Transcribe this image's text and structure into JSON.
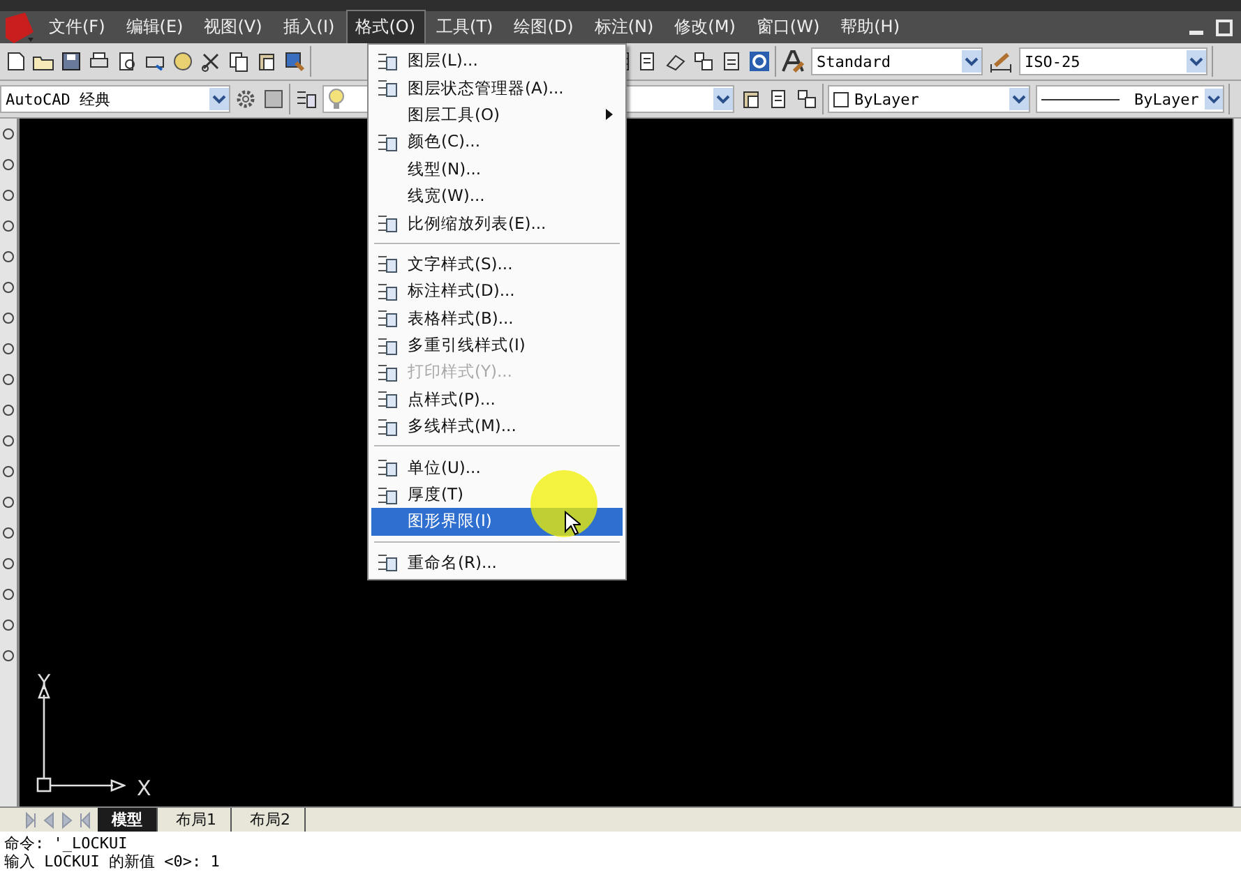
{
  "menubar": {
    "items": [
      {
        "label": "文件(F)",
        "selected": false
      },
      {
        "label": "编辑(E)",
        "selected": false
      },
      {
        "label": "视图(V)",
        "selected": false
      },
      {
        "label": "插入(I)",
        "selected": false
      },
      {
        "label": "格式(O)",
        "selected": true
      },
      {
        "label": "工具(T)",
        "selected": false
      },
      {
        "label": "绘图(D)",
        "selected": false
      },
      {
        "label": "标注(N)",
        "selected": false
      },
      {
        "label": "修改(M)",
        "selected": false
      },
      {
        "label": "窗口(W)",
        "selected": false
      },
      {
        "label": "帮助(H)",
        "selected": false
      }
    ]
  },
  "toolbar": {
    "text_style": "Standard",
    "dim_style": "ISO-25",
    "workspace": "AutoCAD 经典",
    "color_control": "ByLayer",
    "linetype": "ByLayer"
  },
  "format_menu": {
    "items": [
      {
        "kind": "item",
        "label": "图层(L)...",
        "icon": true,
        "disabled": false,
        "selected": false,
        "submenu": false
      },
      {
        "kind": "item",
        "label": "图层状态管理器(A)...",
        "icon": true,
        "disabled": false,
        "selected": false,
        "submenu": false
      },
      {
        "kind": "item",
        "label": "图层工具(O)",
        "icon": false,
        "disabled": false,
        "selected": false,
        "submenu": true
      },
      {
        "kind": "item",
        "label": "颜色(C)...",
        "icon": true,
        "disabled": false,
        "selected": false,
        "submenu": false
      },
      {
        "kind": "item",
        "label": "线型(N)...",
        "icon": false,
        "disabled": false,
        "selected": false,
        "submenu": false
      },
      {
        "kind": "item",
        "label": "线宽(W)...",
        "icon": false,
        "disabled": false,
        "selected": false,
        "submenu": false
      },
      {
        "kind": "item",
        "label": "比例缩放列表(E)...",
        "icon": true,
        "disabled": false,
        "selected": false,
        "submenu": false
      },
      {
        "kind": "separator"
      },
      {
        "kind": "item",
        "label": "文字样式(S)...",
        "icon": true,
        "disabled": false,
        "selected": false,
        "submenu": false
      },
      {
        "kind": "item",
        "label": "标注样式(D)...",
        "icon": true,
        "disabled": false,
        "selected": false,
        "submenu": false
      },
      {
        "kind": "item",
        "label": "表格样式(B)...",
        "icon": true,
        "disabled": false,
        "selected": false,
        "submenu": false
      },
      {
        "kind": "item",
        "label": "多重引线样式(I)",
        "icon": true,
        "disabled": false,
        "selected": false,
        "submenu": false
      },
      {
        "kind": "item",
        "label": "打印样式(Y)...",
        "icon": true,
        "disabled": true,
        "selected": false,
        "submenu": false
      },
      {
        "kind": "item",
        "label": "点样式(P)...",
        "icon": true,
        "disabled": false,
        "selected": false,
        "submenu": false
      },
      {
        "kind": "item",
        "label": "多线样式(M)...",
        "icon": true,
        "disabled": false,
        "selected": false,
        "submenu": false
      },
      {
        "kind": "separator"
      },
      {
        "kind": "item",
        "label": "单位(U)...",
        "icon": true,
        "disabled": false,
        "selected": false,
        "submenu": false
      },
      {
        "kind": "item",
        "label": "厚度(T)",
        "icon": true,
        "disabled": false,
        "selected": false,
        "submenu": false
      },
      {
        "kind": "item",
        "label": "图形界限(I)",
        "icon": false,
        "disabled": false,
        "selected": true,
        "submenu": false
      },
      {
        "kind": "separator"
      },
      {
        "kind": "item",
        "label": "重命名(R)...",
        "icon": true,
        "disabled": false,
        "selected": false,
        "submenu": false
      }
    ]
  },
  "canvas": {
    "ucs_x": "X",
    "ucs_y": "Y"
  },
  "layout_tabs": [
    {
      "label": "模型",
      "selected": true
    },
    {
      "label": "布局1",
      "selected": false
    },
    {
      "label": "布局2",
      "selected": false
    }
  ],
  "command_lines": [
    "命令: '_LOCKUI",
    "输入 LOCKUI 的新值 <0>: 1"
  ]
}
